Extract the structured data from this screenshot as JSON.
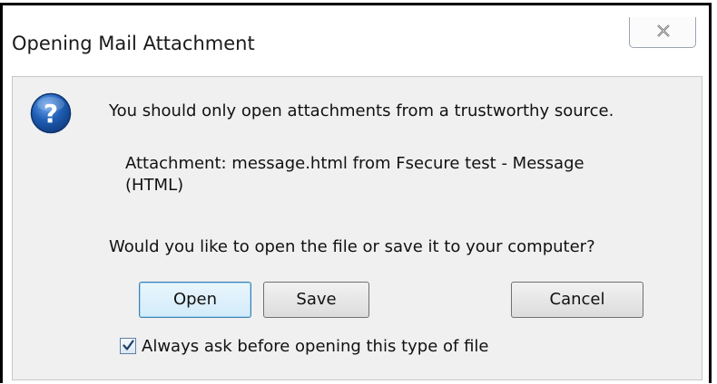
{
  "dialog": {
    "title": "Opening Mail Attachment",
    "close_icon": "close-icon",
    "question_icon": "question-icon",
    "heading": "You should only open attachments from a trustworthy source.",
    "attachment_line1": "Attachment: message.html from Fsecure test - Message",
    "attachment_line2": "(HTML)",
    "question": "Would you like to open the file or save it to your computer?",
    "buttons": {
      "open": "Open",
      "save": "Save",
      "cancel": "Cancel"
    },
    "checkbox": {
      "label": "Always ask before opening this type of file",
      "checked": true
    }
  },
  "colors": {
    "client_background": "#f0f0f0",
    "default_button_border": "#3c7fb1",
    "icon_blue": "#1f5fb5"
  }
}
